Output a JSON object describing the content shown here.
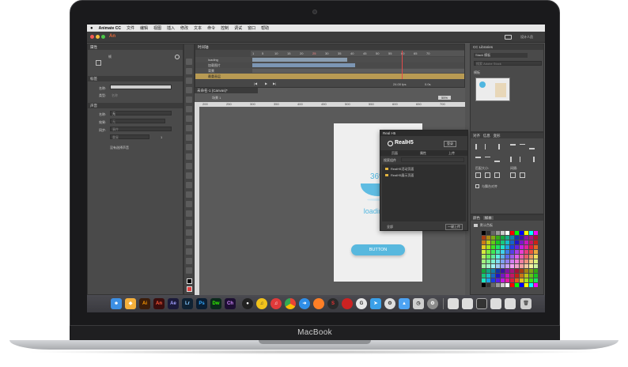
{
  "device": {
    "brand": "MacBook"
  },
  "menubar": {
    "apple": "",
    "items": [
      "Animate CC",
      "文件",
      "编辑",
      "视图",
      "插入",
      "修改",
      "文本",
      "命令",
      "控制",
      "调试",
      "窗口",
      "帮助"
    ]
  },
  "appbar": {
    "logo": "An",
    "workspace": "设计人员"
  },
  "properties": {
    "tab": "属性",
    "frame_label": "帧",
    "section_label": "标签",
    "name_label": "名称:",
    "type_label": "类型:",
    "type_value": "名称",
    "sound_section": "声音",
    "sound_name_label": "名称:",
    "sound_name_value": "无",
    "effect_label": "效果:",
    "effect_value": "无",
    "sync_label": "同步:",
    "sync_value": "事件",
    "repeat_value": "重复",
    "repeat_count": "1",
    "no_sound": "没有选择声音"
  },
  "timeline": {
    "tab": "时间轴",
    "ruler": [
      "1",
      "5",
      "10",
      "15",
      "20",
      "25",
      "30",
      "35",
      "40",
      "45",
      "50",
      "55",
      "60",
      "65",
      "70"
    ],
    "layers": [
      "loading",
      "加载图片",
      "背景",
      "最重画层"
    ],
    "fps_readout": "24.00 fps",
    "time_readout": "0.0s"
  },
  "stage": {
    "doc_tab": "未命名-1 (Canvas)*",
    "scene": "场景 1",
    "zoom": "55%",
    "ruler": [
      "200",
      "250",
      "300",
      "350",
      "400",
      "450",
      "500",
      "550",
      "600",
      "650",
      "700"
    ],
    "percent": "36%",
    "loading_text": "loading...",
    "button_label": "BUTTON"
  },
  "realh5": {
    "title": "Real H5",
    "logo_text": "RealH5",
    "login": "登录",
    "tabs": [
      "页面",
      "属性",
      "上传"
    ],
    "search_label": "搜索组件",
    "items": [
      "RealH5活动页面",
      "RealH5展示页面"
    ],
    "footer_left": "全部",
    "footer_right": "一键上传"
  },
  "libraries": {
    "tab": "CC Libraries",
    "library_name": "Stack 模板",
    "search_placeholder": "搜索 Adobe Stock",
    "section": "模板"
  },
  "align": {
    "tabs": [
      "对齐",
      "信息",
      "变形"
    ],
    "spacing_label": "间隔:",
    "match_label": "匹配大小:",
    "stage_label": "与舞台对齐"
  },
  "swatches": {
    "tabs": [
      "颜色",
      "样本"
    ],
    "group": "默认色板"
  },
  "dock": {
    "apps": [
      "Finder",
      "Sketch",
      "Ai",
      "An",
      "Ae",
      "Lr",
      "Ps",
      "Dw",
      "Ch",
      "QQ",
      "Music",
      "NetEase",
      "Chrome",
      "Safari",
      "Firefox",
      "Sogou",
      "Game",
      "Mail",
      "Maps",
      "Tools",
      "Keynote",
      "Preview"
    ]
  },
  "colors": {
    "ui_dark": "#535353",
    "accent_blue": "#4fb6e0",
    "playhead": "#e14b4b",
    "stage_bg": "#efefef"
  }
}
